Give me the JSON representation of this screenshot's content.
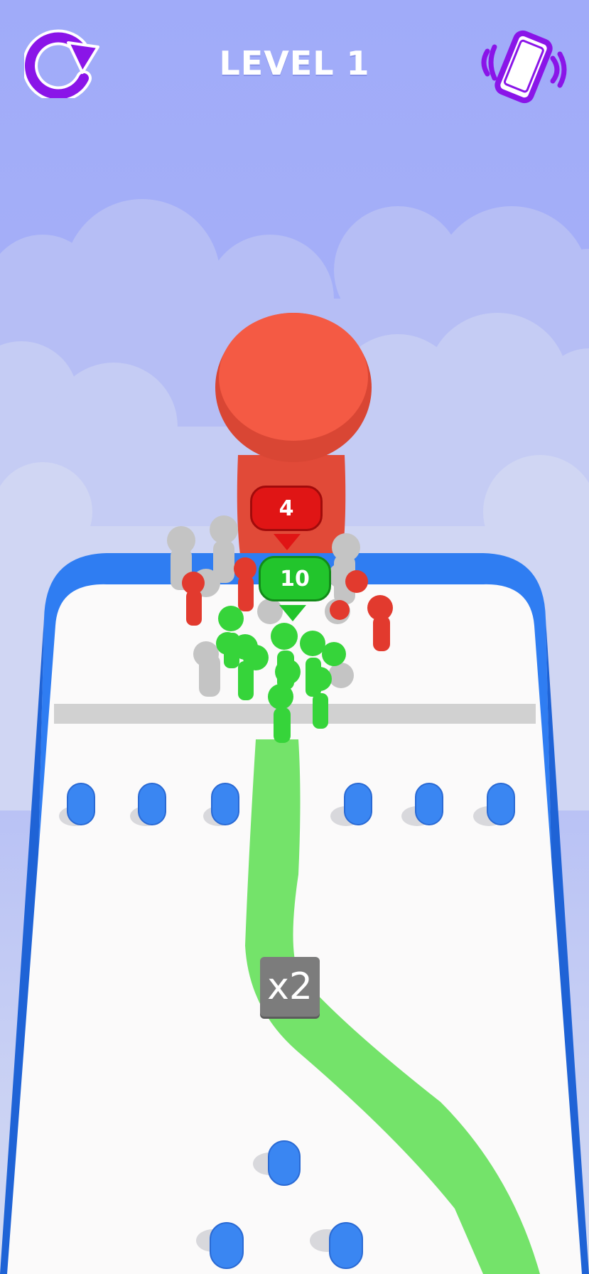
{
  "hud": {
    "level_title": "LEVEL 1",
    "restart_icon": "restart-icon",
    "vibration_icon": "vibration-phone-icon"
  },
  "game": {
    "enemy_count": "4",
    "player_count": "10",
    "multiplier_label": "x2"
  },
  "colors": {
    "sky": "#a3aefa",
    "accent_purple": "#8a15e8",
    "enemy_red": "#f45a44",
    "badge_red": "#e01515",
    "player_green": "#36d43a",
    "badge_green": "#22c52c",
    "track_blue": "#2f7df2",
    "path_green": "#74e36a"
  }
}
